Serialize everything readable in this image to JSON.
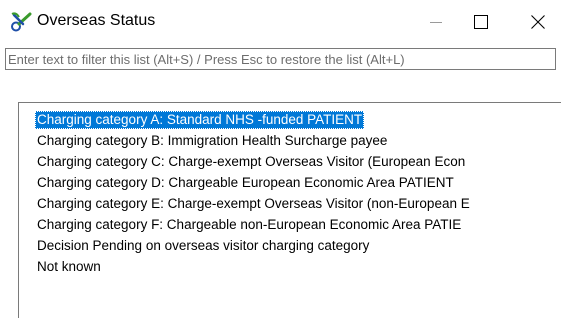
{
  "window": {
    "title": "Overseas Status",
    "icon": "scissors-icon"
  },
  "controls": {
    "minimize_icon": "minimize-icon",
    "maximize_icon": "maximize-icon",
    "close_icon": "close-icon"
  },
  "filter": {
    "placeholder": "Enter text to filter this list (Alt+S) / Press Esc to restore the list (Alt+L)",
    "value": ""
  },
  "list": {
    "selected_index": 0,
    "items": [
      "Charging category A: Standard NHS -funded PATIENT",
      "Charging category B: Immigration Health Surcharge payee",
      "Charging category C: Charge-exempt Overseas Visitor (European Econ",
      "Charging category D: Chargeable European Economic Area PATIENT",
      "Charging category E: Charge-exempt Overseas Visitor (non-European E",
      "Charging category F: Chargeable non-European Economic Area PATIE",
      "Decision Pending on overseas visitor charging category",
      "Not known"
    ]
  },
  "colors": {
    "selection": "#0078d7",
    "icon_green": "#3a9a2c",
    "icon_blue": "#1f4fa8"
  }
}
